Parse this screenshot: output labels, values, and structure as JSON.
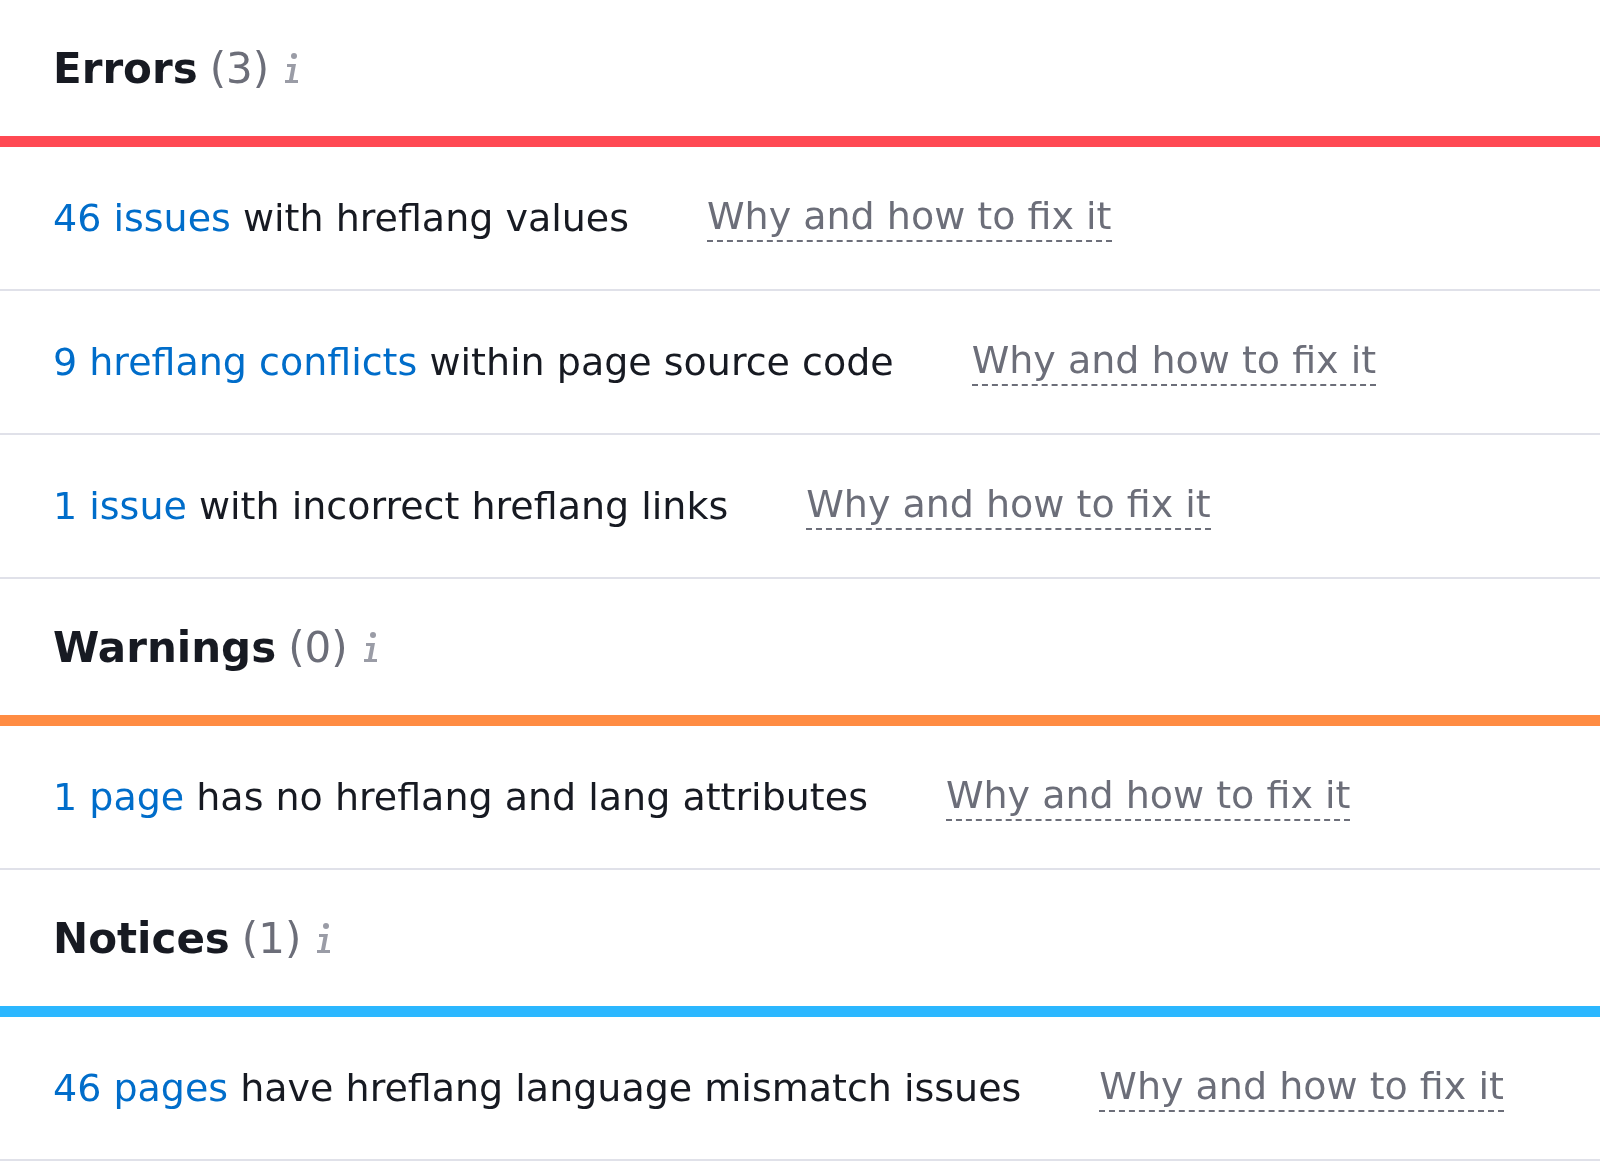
{
  "sections": [
    {
      "title": "Errors",
      "count": "(3)",
      "color": "#ff4953",
      "issues": [
        {
          "link": "46 issues",
          "text": "with hreflang values",
          "help": "Why and how to fix it"
        },
        {
          "link": "9 hreflang conflicts",
          "text": "within page source code",
          "help": "Why and how to fix it"
        },
        {
          "link": "1 issue",
          "text": "with incorrect hreflang links",
          "help": "Why and how to fix it"
        }
      ]
    },
    {
      "title": "Warnings",
      "count": "(0)",
      "color": "#ff8c43",
      "issues": [
        {
          "link": "1 page",
          "text": "has no hreflang and lang attributes",
          "help": "Why and how to fix it"
        }
      ]
    },
    {
      "title": "Notices",
      "count": "(1)",
      "color": "#2bb7ff",
      "issues": [
        {
          "link": "46 pages",
          "text": "have hreflang language mismatch issues",
          "help": "Why and how to fix it"
        }
      ]
    }
  ]
}
